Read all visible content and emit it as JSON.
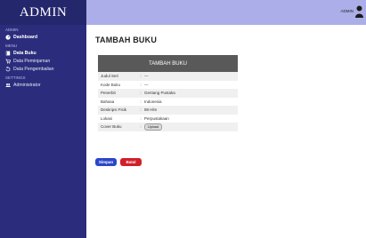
{
  "sidebar": {
    "brand": "ADMIN",
    "sections": [
      {
        "label": "ADMIN",
        "items": [
          {
            "label": "Dashboard",
            "icon": "dashboard-icon",
            "bold": true
          }
        ]
      },
      {
        "label": "MENU",
        "items": [
          {
            "label": "Data Buku",
            "icon": "book-icon",
            "bold": true
          },
          {
            "label": "Data Peminjaman",
            "icon": "cart-icon",
            "bold": false
          },
          {
            "label": "Data Pengembalian",
            "icon": "return-icon",
            "bold": false
          }
        ]
      },
      {
        "label": "SETTINGS",
        "items": [
          {
            "label": "Administrator",
            "icon": "users-icon",
            "bold": false
          }
        ]
      }
    ]
  },
  "topbar": {
    "user_label": "ADMIN"
  },
  "page": {
    "title": "TAMBAH BUKU"
  },
  "form": {
    "header": "TAMBAH BUKU",
    "rows": [
      {
        "label": "Judul Seri",
        "value": "—"
      },
      {
        "label": "Kode Buku",
        "value": "—"
      },
      {
        "label": "Penerbit",
        "value": "Gentang Pustaka"
      },
      {
        "label": "Bahasa",
        "value": "Indonesia"
      },
      {
        "label": "Deskripsi Fisik",
        "value": "98 Hlm"
      },
      {
        "label": "Lokasi",
        "value": "Perpustakaan"
      },
      {
        "label": "Cover Buku",
        "value": "Upload"
      }
    ]
  },
  "buttons": {
    "save": "Simpan",
    "cancel": "Batal"
  },
  "colors": {
    "sidebar": "#2b2d7c",
    "topbar": "#abaee8",
    "form_header": "#595959",
    "save": "#2b46c9",
    "cancel": "#d11f2b"
  }
}
